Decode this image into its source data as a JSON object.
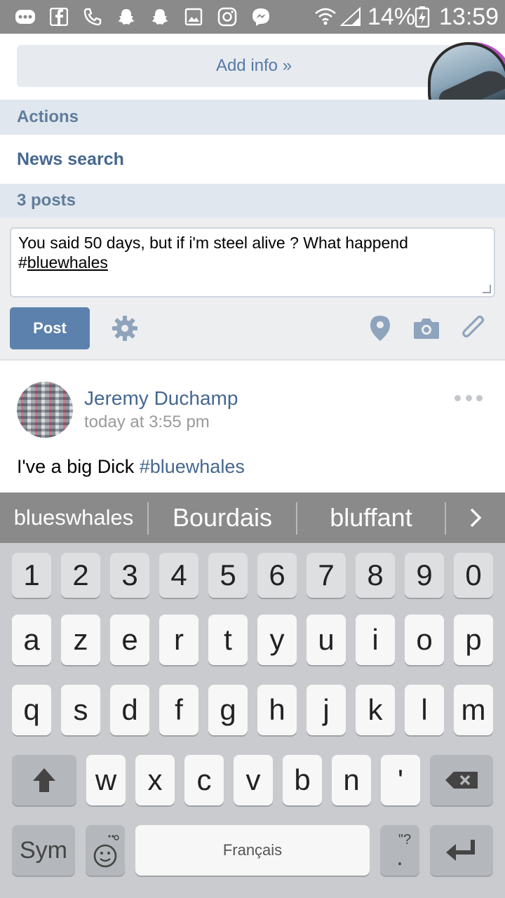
{
  "status_bar": {
    "battery": "14%",
    "time": "13:59",
    "icons": [
      "more-icon",
      "facebook-icon",
      "phone-icon",
      "snapchat-icon",
      "snapchat-icon",
      "gallery-icon",
      "instagram-icon",
      "messenger-icon",
      "wifi-icon",
      "signal-icon",
      "battery-icon"
    ]
  },
  "profile": {
    "add_info_label": "Add info »",
    "avatar_icon": "profile-avatar"
  },
  "sections": {
    "actions_label": "Actions",
    "news_search_label": "News search",
    "posts_count_label": "3 posts"
  },
  "composer": {
    "text_line1": "You said 50 days,  but if i'm steel alive ? What happend",
    "text_hash": "#",
    "text_tag": "bluewhales",
    "post_label": "Post",
    "icons": [
      "gear-icon",
      "location-pin-icon",
      "camera-icon",
      "paperclip-icon"
    ]
  },
  "post": {
    "author": "Jeremy Duchamp",
    "time": "today at 3:55 pm",
    "text": "I've a big Dick ",
    "hashtag": "#bluewhales",
    "menu_icon": "more-horizontal-icon",
    "accent": "#45678f"
  },
  "suggestions": {
    "items": [
      "blueswhales",
      "Bourdais",
      "bluffant"
    ],
    "more_icon": "chevron-right-icon"
  },
  "keyboard": {
    "number_row": [
      "1",
      "2",
      "3",
      "4",
      "5",
      "6",
      "7",
      "8",
      "9",
      "0"
    ],
    "row1": [
      "a",
      "z",
      "e",
      "r",
      "t",
      "y",
      "u",
      "i",
      "o",
      "p"
    ],
    "row2": [
      "q",
      "s",
      "d",
      "f",
      "g",
      "h",
      "j",
      "k",
      "l",
      "m"
    ],
    "row3": [
      "w",
      "x",
      "c",
      "v",
      "b",
      "n",
      "'"
    ],
    "sym_label": "Sym",
    "space_label": "Français",
    "punct_hint": "\"?",
    "punct_main": "."
  },
  "colors": {
    "status_bar": "#8a8a8a",
    "link_blue": "#45678f",
    "post_button": "#5c81ad",
    "section_bg": "#e1e7ee",
    "keyboard_bg": "#c9cbce"
  }
}
